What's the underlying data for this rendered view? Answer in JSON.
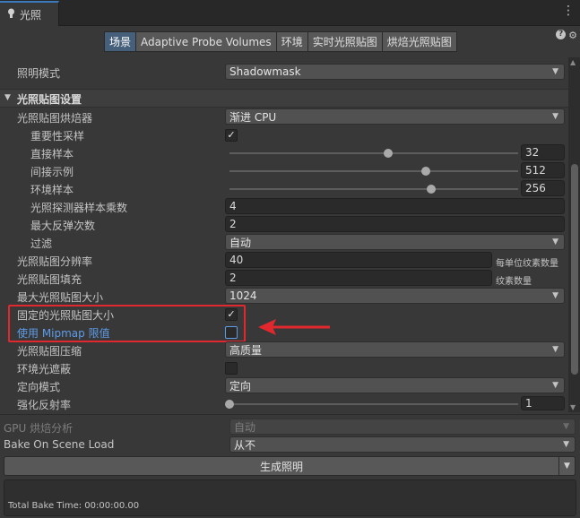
{
  "window": {
    "tab_title": "光照",
    "menu_glyph": "⋮"
  },
  "toolbar": {
    "tabs": [
      "场景",
      "Adaptive Probe Volumes",
      "环境",
      "实时光照贴图",
      "烘焙光照贴图"
    ],
    "active_index": 0,
    "help_glyph": "?",
    "settings_glyph": "⚙"
  },
  "lighting_mode": {
    "label": "照明模式",
    "value": "Shadowmask"
  },
  "section": {
    "title": "光照贴图设置"
  },
  "settings": {
    "baker": {
      "label": "光照贴图烘焙器",
      "value": "渐进 CPU"
    },
    "importance_sampling": {
      "label": "重要性采样",
      "checked": true
    },
    "direct_samples": {
      "label": "直接样本",
      "value": "32",
      "fraction": 0.55
    },
    "indirect_samples": {
      "label": "间接示例",
      "value": "512",
      "fraction": 0.68
    },
    "environment_samples": {
      "label": "环境样本",
      "value": "256",
      "fraction": 0.7
    },
    "probe_multiplier": {
      "label": "光照探测器样本乘数",
      "value": "4"
    },
    "max_bounces": {
      "label": "最大反弹次数",
      "value": "2"
    },
    "filter": {
      "label": "过滤",
      "value": "自动"
    },
    "resolution": {
      "label": "光照贴图分辨率",
      "value": "40",
      "unit": "每单位纹素数量"
    },
    "padding": {
      "label": "光照贴图填充",
      "value": "2",
      "unit": "纹素数量"
    },
    "max_size": {
      "label": "最大光照贴图大小",
      "value": "1024"
    },
    "fixed_size": {
      "label": "固定的光照贴图大小",
      "checked": true
    },
    "mipmap_limit": {
      "label": "使用 Mipmap 限值",
      "checked": false
    },
    "compression": {
      "label": "光照贴图压缩",
      "value": "高质量"
    },
    "ambient_occlusion": {
      "label": "环境光遮蔽",
      "checked": false
    },
    "directional_mode": {
      "label": "定向模式",
      "value": "定向"
    },
    "albedo_boost": {
      "label": "强化反射率",
      "value": "1",
      "fraction": 0.0
    }
  },
  "bottom": {
    "gpu_profile": {
      "label": "GPU 烘焙分析",
      "value": "自动"
    },
    "bake_on_load": {
      "label": "Bake On Scene Load",
      "value": "从不"
    },
    "generate_button": "生成照明",
    "bake_time": "Total Bake Time: 00:00:00.00"
  },
  "annotation": {
    "highlight_color": "#e0282e"
  }
}
